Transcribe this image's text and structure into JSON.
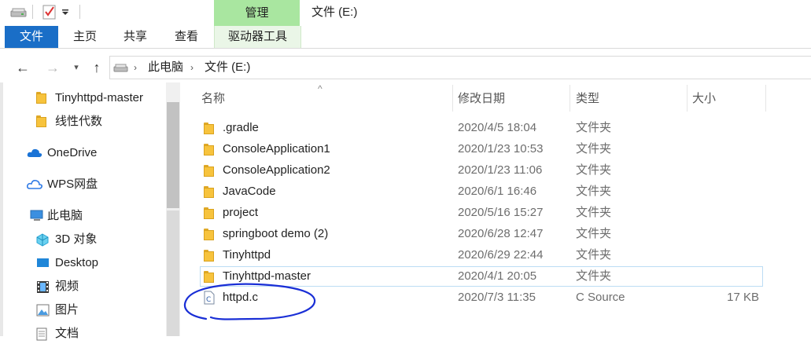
{
  "titlebar": {
    "contextual_tab": "管理",
    "window_title": "文件 (E:)"
  },
  "ribbon": {
    "tabs": [
      "文件",
      "主页",
      "共享",
      "查看",
      "驱动器工具"
    ]
  },
  "address": {
    "crumbs": [
      "此电脑",
      "文件 (E:)"
    ]
  },
  "nav": {
    "items": [
      {
        "label": "Tinyhttpd-master",
        "icon": "folder-icon"
      },
      {
        "label": "线性代数",
        "icon": "folder-icon"
      },
      {
        "label": "OneDrive",
        "icon": "onedrive-icon"
      },
      {
        "label": "WPS网盘",
        "icon": "wps-cloud-icon"
      },
      {
        "label": "此电脑",
        "icon": "computer-icon"
      },
      {
        "label": "3D 对象",
        "icon": "3d-objects-icon"
      },
      {
        "label": "Desktop",
        "icon": "desktop-icon"
      },
      {
        "label": "视频",
        "icon": "video-icon"
      },
      {
        "label": "图片",
        "icon": "pictures-icon"
      },
      {
        "label": "文档",
        "icon": "documents-icon"
      }
    ]
  },
  "list": {
    "columns": {
      "name": "名称",
      "date": "修改日期",
      "type": "类型",
      "size": "大小"
    },
    "rows": [
      {
        "name": ".gradle",
        "date": "2020/4/5 18:04",
        "type": "文件夹",
        "size": ""
      },
      {
        "name": "ConsoleApplication1",
        "date": "2020/1/23 10:53",
        "type": "文件夹",
        "size": ""
      },
      {
        "name": "ConsoleApplication2",
        "date": "2020/1/23 11:06",
        "type": "文件夹",
        "size": ""
      },
      {
        "name": "JavaCode",
        "date": "2020/6/1 16:46",
        "type": "文件夹",
        "size": ""
      },
      {
        "name": "project",
        "date": "2020/5/16 15:27",
        "type": "文件夹",
        "size": ""
      },
      {
        "name": "springboot demo (2)",
        "date": "2020/6/28 12:47",
        "type": "文件夹",
        "size": ""
      },
      {
        "name": "Tinyhttpd",
        "date": "2020/6/29 22:44",
        "type": "文件夹",
        "size": ""
      },
      {
        "name": "Tinyhttpd-master",
        "date": "2020/4/1 20:05",
        "type": "文件夹",
        "size": ""
      },
      {
        "name": "httpd.c",
        "date": "2020/7/3 11:35",
        "type": "C Source",
        "size": "17 KB"
      }
    ]
  },
  "colors": {
    "accent": "#1a6ec7",
    "contextual": "#a9e6a0",
    "annotation": "#1a2fd6",
    "folder": "#f7c33d"
  }
}
